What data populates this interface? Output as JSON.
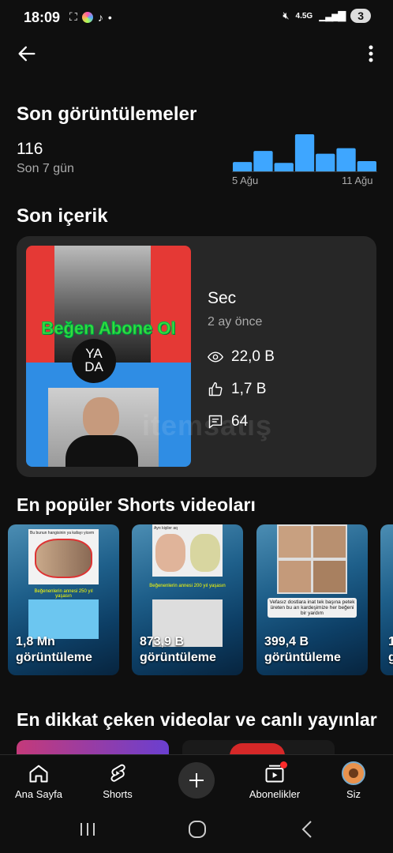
{
  "status_bar": {
    "time": "18:09",
    "network": "4.5G",
    "battery": "3"
  },
  "header": {
    "back_icon": "arrow-left-icon",
    "menu_icon": "more-vert-icon"
  },
  "recent_views": {
    "title": "Son görüntülemeler",
    "count": "116",
    "period": "Son 7 gün",
    "chart_start_label": "5 Ağu",
    "chart_end_label": "11 Ağu",
    "bar_color": "#3ea6ff"
  },
  "chart_data": {
    "type": "bar",
    "categories": [
      "5 Ağu",
      "6 Ağu",
      "7 Ağu",
      "8 Ağu",
      "9 Ağu",
      "10 Ağu",
      "11 Ağu"
    ],
    "values": [
      11,
      23,
      10,
      41,
      20,
      26,
      12
    ],
    "title": "",
    "xlabel": "",
    "ylabel": "",
    "grid": false
  },
  "latest_content": {
    "section_title": "Son içerik",
    "video_title": "Sec",
    "published": "2 ay önce",
    "thumbnail_headline": "Beğen Abone Ol",
    "thumbnail_badge_1": "YA",
    "thumbnail_badge_2": "DA",
    "views": "22,0 B",
    "likes": "1,7 B",
    "comments": "64",
    "watermark": "itemsatış"
  },
  "popular_shorts": {
    "section_title": "En popüler Shorts videoları",
    "items": [
      {
        "value": "1,8 Mn",
        "unit": "görüntüleme",
        "panel_top_text": "Bu bunun hangisinin ya kafayı yicem",
        "panel_mid_text": "Beğenenlerin annesi 250 yıl yaşasın"
      },
      {
        "value": "873,9 B",
        "unit": "görüntüleme",
        "panel_top_text": "Ayrı kişiler aq",
        "panel_mid_text": "Beğenenlerin annesi 200 yıl yaşasın"
      },
      {
        "value": "399,4 B",
        "unit": "görüntüleme",
        "panel_top_text": "Vefasız dostlara inat tek başına petek üreten bu arı kardeşimize her beğeni bir yardım"
      },
      {
        "value": "1",
        "unit": "g"
      }
    ]
  },
  "notable": {
    "section_title": "En dikkat çeken videolar ve canlı yayınlar"
  },
  "bottom_nav": {
    "home": "Ana Sayfa",
    "shorts": "Shorts",
    "subscriptions": "Abonelikler",
    "you": "Siz"
  }
}
